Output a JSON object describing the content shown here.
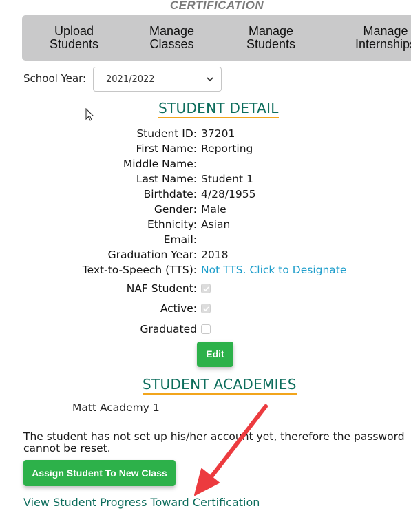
{
  "header": {
    "section_label": "CERTIFICATION"
  },
  "nav": {
    "items": [
      {
        "line1": "Upload",
        "line2": "Students"
      },
      {
        "line1": "Manage",
        "line2": "Classes"
      },
      {
        "line1": "Manage",
        "line2": "Students"
      },
      {
        "line1": "Manage",
        "line2": "Internships"
      }
    ]
  },
  "school_year": {
    "label": "School Year:",
    "selected": "2021/2022",
    "icon": "chevron-down-icon"
  },
  "student_detail": {
    "title": "STUDENT DETAIL",
    "fields": [
      {
        "label": "Student ID:",
        "value": "37201"
      },
      {
        "label": "First Name:",
        "value": "Reporting"
      },
      {
        "label": "Middle Name:",
        "value": ""
      },
      {
        "label": "Last Name:",
        "value": "Student 1"
      },
      {
        "label": "Birthdate:",
        "value": "4/28/1955"
      },
      {
        "label": "Gender:",
        "value": "Male"
      },
      {
        "label": "Ethnicity:",
        "value": "Asian"
      },
      {
        "label": "Email:",
        "value": ""
      },
      {
        "label": "Graduation Year:",
        "value": "2018"
      },
      {
        "label": "Text-to-Speech (TTS):",
        "value": "Not TTS. Click to Designate"
      }
    ],
    "checkboxes": [
      {
        "label": "NAF Student:",
        "checked": true,
        "disabled": true
      },
      {
        "label": "Active:",
        "checked": true,
        "disabled": true
      },
      {
        "label": "Graduated",
        "checked": false,
        "disabled": true
      }
    ],
    "edit_label": "Edit"
  },
  "academies": {
    "title": "STUDENT ACADEMIES",
    "items": [
      "Matt Academy 1"
    ],
    "notice": "The student has not set up his/her account yet, therefore the password cannot be reset.",
    "assign_label": "Assign Student To New Class",
    "progress_link": "View Student Progress Toward Certification"
  },
  "colors": {
    "accent_green": "#2db14a",
    "heading_teal": "#0d6d5c",
    "underline_orange": "#f2a51c",
    "link_blue": "#1f9ecb",
    "nav_gray": "#c9c9ca",
    "annotation_red": "#ec3b3f"
  }
}
